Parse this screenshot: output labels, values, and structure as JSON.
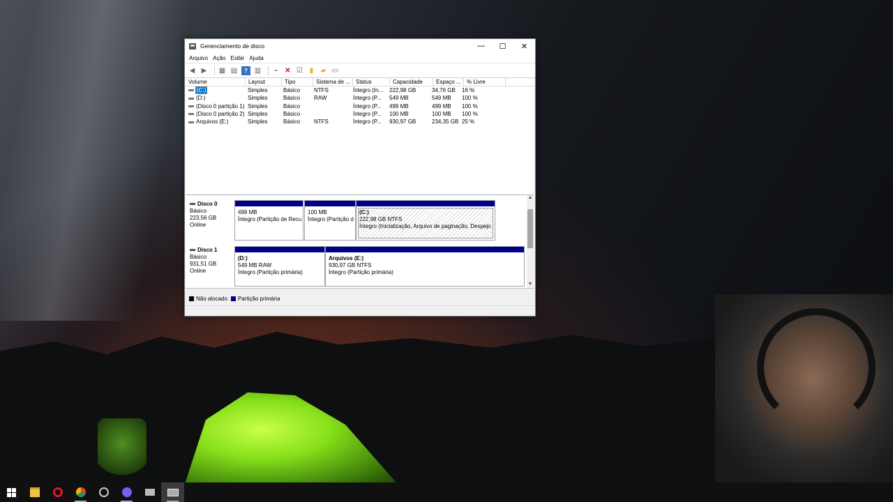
{
  "window": {
    "title": "Gerenciamento de disco",
    "controls": {
      "minimize": "—",
      "maximize": "☐",
      "close": "✕"
    }
  },
  "menu": [
    "Arquivo",
    "Ação",
    "Exibir",
    "Ajuda"
  ],
  "columns": [
    "Volume",
    "Layout",
    "Tipo",
    "Sistema de ...",
    "Status",
    "Capacidade",
    "Espaço ...",
    "% Livre"
  ],
  "volumes": [
    [
      "(C:)",
      "Simples",
      "Básico",
      "NTFS",
      "Íntegro (In...",
      "222,98 GB",
      "34,76 GB",
      "16 %"
    ],
    [
      "(D:)",
      "Simples",
      "Básico",
      "RAW",
      "Íntegro (P...",
      "549 MB",
      "549 MB",
      "100 %"
    ],
    [
      "(Disco 0 partição 1)",
      "Simples",
      "Básico",
      "",
      "Íntegro (P...",
      "499 MB",
      "499 MB",
      "100 %"
    ],
    [
      "(Disco 0 partição 2)",
      "Simples",
      "Básico",
      "",
      "Íntegro (P...",
      "100 MB",
      "100 MB",
      "100 %"
    ],
    [
      "Arquivos (E:)",
      "Simples",
      "Básico",
      "NTFS",
      "Íntegro (P...",
      "930,97 GB",
      "234,35 GB",
      "25 %"
    ]
  ],
  "disks": [
    {
      "name": "Disco 0",
      "type": "Básico",
      "size": "223,56 GB",
      "state": "Online",
      "partitions": [
        {
          "label": "",
          "size": "499 MB",
          "status": "Íntegro (Partição de Recu"
        },
        {
          "label": "",
          "size": "100 MB",
          "status": "Íntegro (Partição d"
        },
        {
          "label": "(C:)",
          "size": "222,98 GB NTFS",
          "status": "Íntegro (Inicialização, Arquivo de paginação, Despejo"
        }
      ]
    },
    {
      "name": "Disco 1",
      "type": "Básico",
      "size": "931,51 GB",
      "state": "Online",
      "partitions": [
        {
          "label": "(D:)",
          "size": "549 MB RAW",
          "status": "Íntegro (Partição primária)"
        },
        {
          "label": "Arquivos  (E:)",
          "size": "930,97 GB NTFS",
          "status": "Íntegro (Partição primária)"
        }
      ]
    }
  ],
  "legend": [
    {
      "label": "Não alocado",
      "color": "#000000"
    },
    {
      "label": "Partição primária",
      "color": "#00008b"
    }
  ]
}
